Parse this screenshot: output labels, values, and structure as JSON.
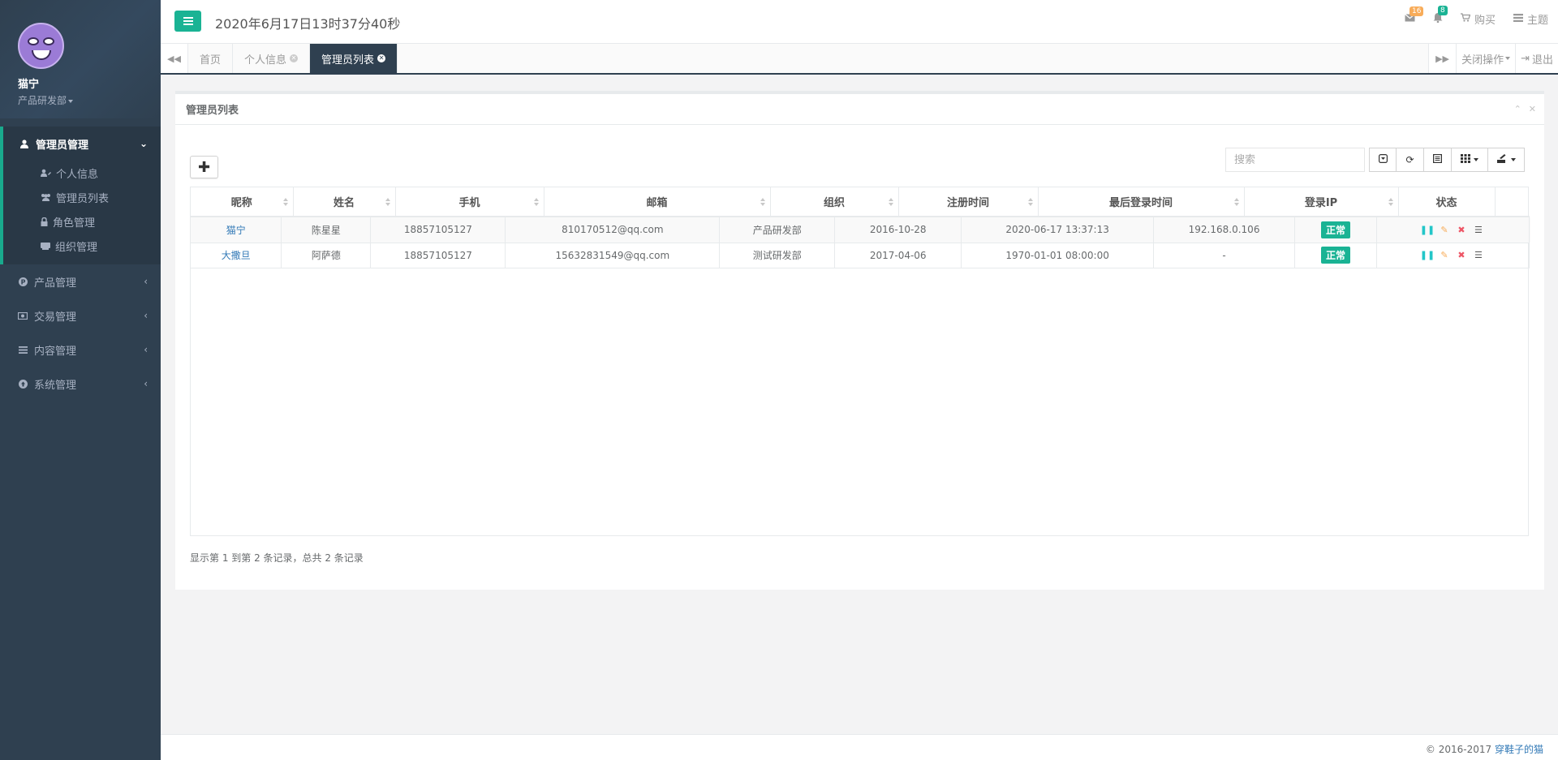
{
  "profile": {
    "name": "猫宁",
    "department": "产品研发部"
  },
  "sidebar": {
    "groups": [
      {
        "label": "管理员管理",
        "arrow": "⌄",
        "items": [
          {
            "label": "个人信息"
          },
          {
            "label": "管理员列表"
          },
          {
            "label": "角色管理"
          },
          {
            "label": "组织管理"
          }
        ]
      },
      {
        "label": "产品管理",
        "arrow": "‹"
      },
      {
        "label": "交易管理",
        "arrow": "‹"
      },
      {
        "label": "内容管理",
        "arrow": "‹"
      },
      {
        "label": "系统管理",
        "arrow": "‹"
      }
    ]
  },
  "topbar": {
    "datetime": "2020年6月17日13时37分40秒",
    "mail_count": "16",
    "bell_count": "8",
    "buy_label": "购买",
    "theme_label": "主题"
  },
  "tabs": {
    "items": [
      "首页",
      "个人信息",
      "管理员列表"
    ],
    "close_ops_label": "关闭操作",
    "logout_label": "退出"
  },
  "panel": {
    "title": "管理员列表",
    "search_placeholder": "搜索"
  },
  "table": {
    "columns": [
      "昵称",
      "姓名",
      "手机",
      "邮箱",
      "组织",
      "注册时间",
      "最后登录时间",
      "登录IP",
      "状态"
    ],
    "rows": [
      {
        "nickname": "猫宁",
        "name": "陈星星",
        "phone": "18857105127",
        "email": "810170512@qq.com",
        "org": "产品研发部",
        "registered": "2016-10-28",
        "last_login": "2020-06-17 13:37:13",
        "ip": "192.168.0.106",
        "status": "正常"
      },
      {
        "nickname": "大撒旦",
        "name": "阿萨德",
        "phone": "18857105127",
        "email": "15632831549@qq.com",
        "org": "测试研发部",
        "registered": "2017-04-06",
        "last_login": "1970-01-01 08:00:00",
        "ip": "-",
        "status": "正常"
      }
    ]
  },
  "pager": {
    "info": "显示第 1 到第 2 条记录，总共 2 条记录"
  },
  "footer": {
    "copyright": "© 2016-2017",
    "link": "穿鞋子的猫"
  },
  "colors": {
    "sidebar": "#2f4050",
    "accent": "#1ab394",
    "link": "#337ab7",
    "warning": "#f8ac59",
    "danger": "#ed5565",
    "info": "#23c6c8"
  }
}
